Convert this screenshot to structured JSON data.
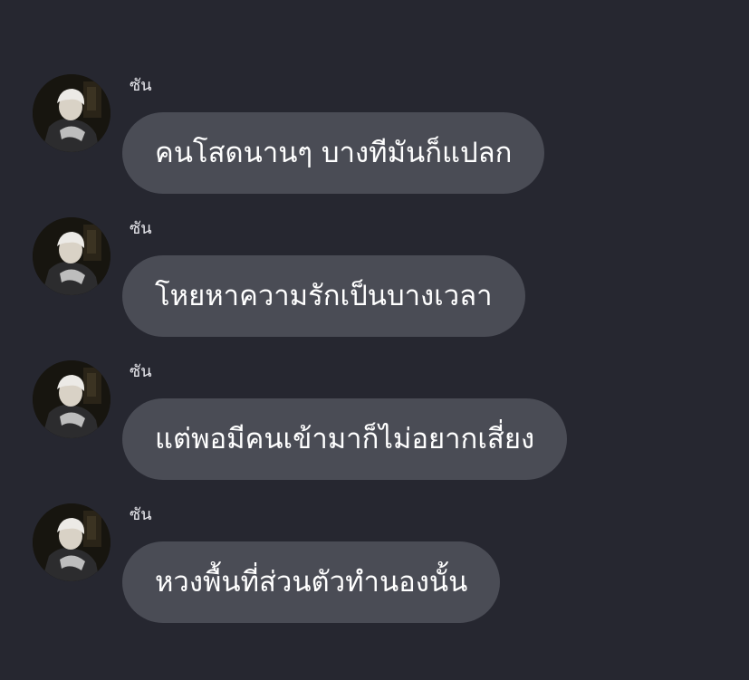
{
  "colors": {
    "background": "#262730",
    "bubble": "#4a4c55",
    "text": "#ffffff",
    "sender_text": "#e9e9ee"
  },
  "messages": [
    {
      "sender": "ซัน",
      "avatar": "profile-photo",
      "text": "คนโสดนานๆ บางทีมันก็แปลก"
    },
    {
      "sender": "ซัน",
      "avatar": "profile-photo",
      "text": "โหยหาความรักเป็นบางเวลา"
    },
    {
      "sender": "ซัน",
      "avatar": "profile-photo",
      "text": "แต่พอมีคนเข้ามาก็ไม่อยากเสี่ยง"
    },
    {
      "sender": "ซัน",
      "avatar": "profile-photo",
      "text": "หวงพื้นที่ส่วนตัวทำนองนั้น"
    }
  ]
}
